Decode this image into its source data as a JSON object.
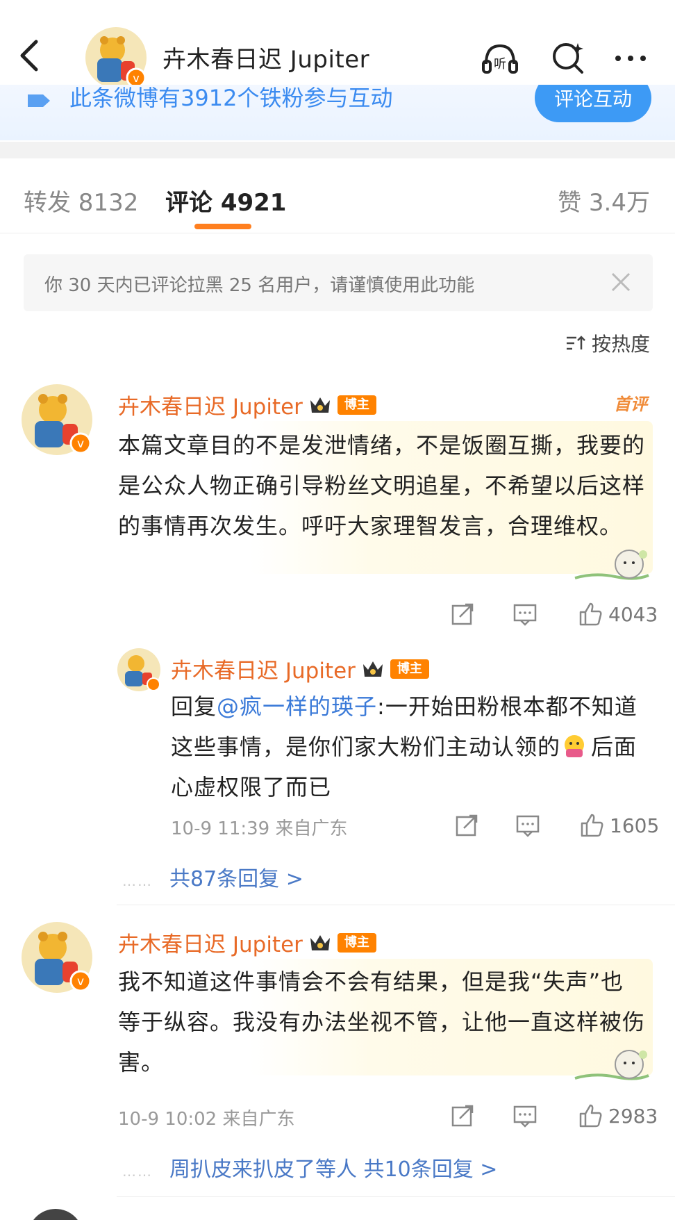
{
  "header": {
    "title": "卉木春日迟 Jupiter"
  },
  "fan_banner": {
    "text": "此条微博有3912个铁粉参与互动",
    "button_label": "评论互动"
  },
  "tabs": {
    "repost": "转发 8132",
    "comment": "评论 4921",
    "like": "赞 3.4万"
  },
  "notice": {
    "text": "你 30 天内已评论拉黑 25 名用户，请谨慎使用此功能"
  },
  "sort": {
    "label": "按热度"
  },
  "comments": [
    {
      "user": "卉木春日迟 Jupiter",
      "badge": "博主",
      "tag": "首评",
      "text": "本篇文章目的不是发泄情绪，不是饭圈互撕，我要的是公众人物正确引导粉丝文明追星，不希望以后这样的事情再次发生。呼吁大家理智发言，合理维权。",
      "likes": "4043",
      "reply": {
        "user": "卉木春日迟 Jupiter",
        "badge": "博主",
        "prefix": "回复",
        "mention": "@疯一样的瑛子",
        "text": ":一开始田粉根本都不知道这些事情，是你们家大粉们主动认领的",
        "text2": "后面心虚权限了而已",
        "meta": "10-9 11:39 来自广东",
        "likes": "1605"
      },
      "more_replies": "共87条回复 >"
    },
    {
      "user": "卉木春日迟 Jupiter",
      "badge": "博主",
      "text": "我不知道这件事情会不会有结果，但是我“失声”也等于纵容。我没有办法坐视不管，让他一直这样被伤害。",
      "meta": "10-9 10:02 来自广东",
      "likes": "2983",
      "more_replies": "周扒皮来扒皮了等人 共10条回复 >"
    }
  ],
  "colors": {
    "accent_orange": "#ff7f1f",
    "username_orange": "#e86a27",
    "link_blue": "#4a79c6",
    "badge_orange": "#ff8200"
  }
}
